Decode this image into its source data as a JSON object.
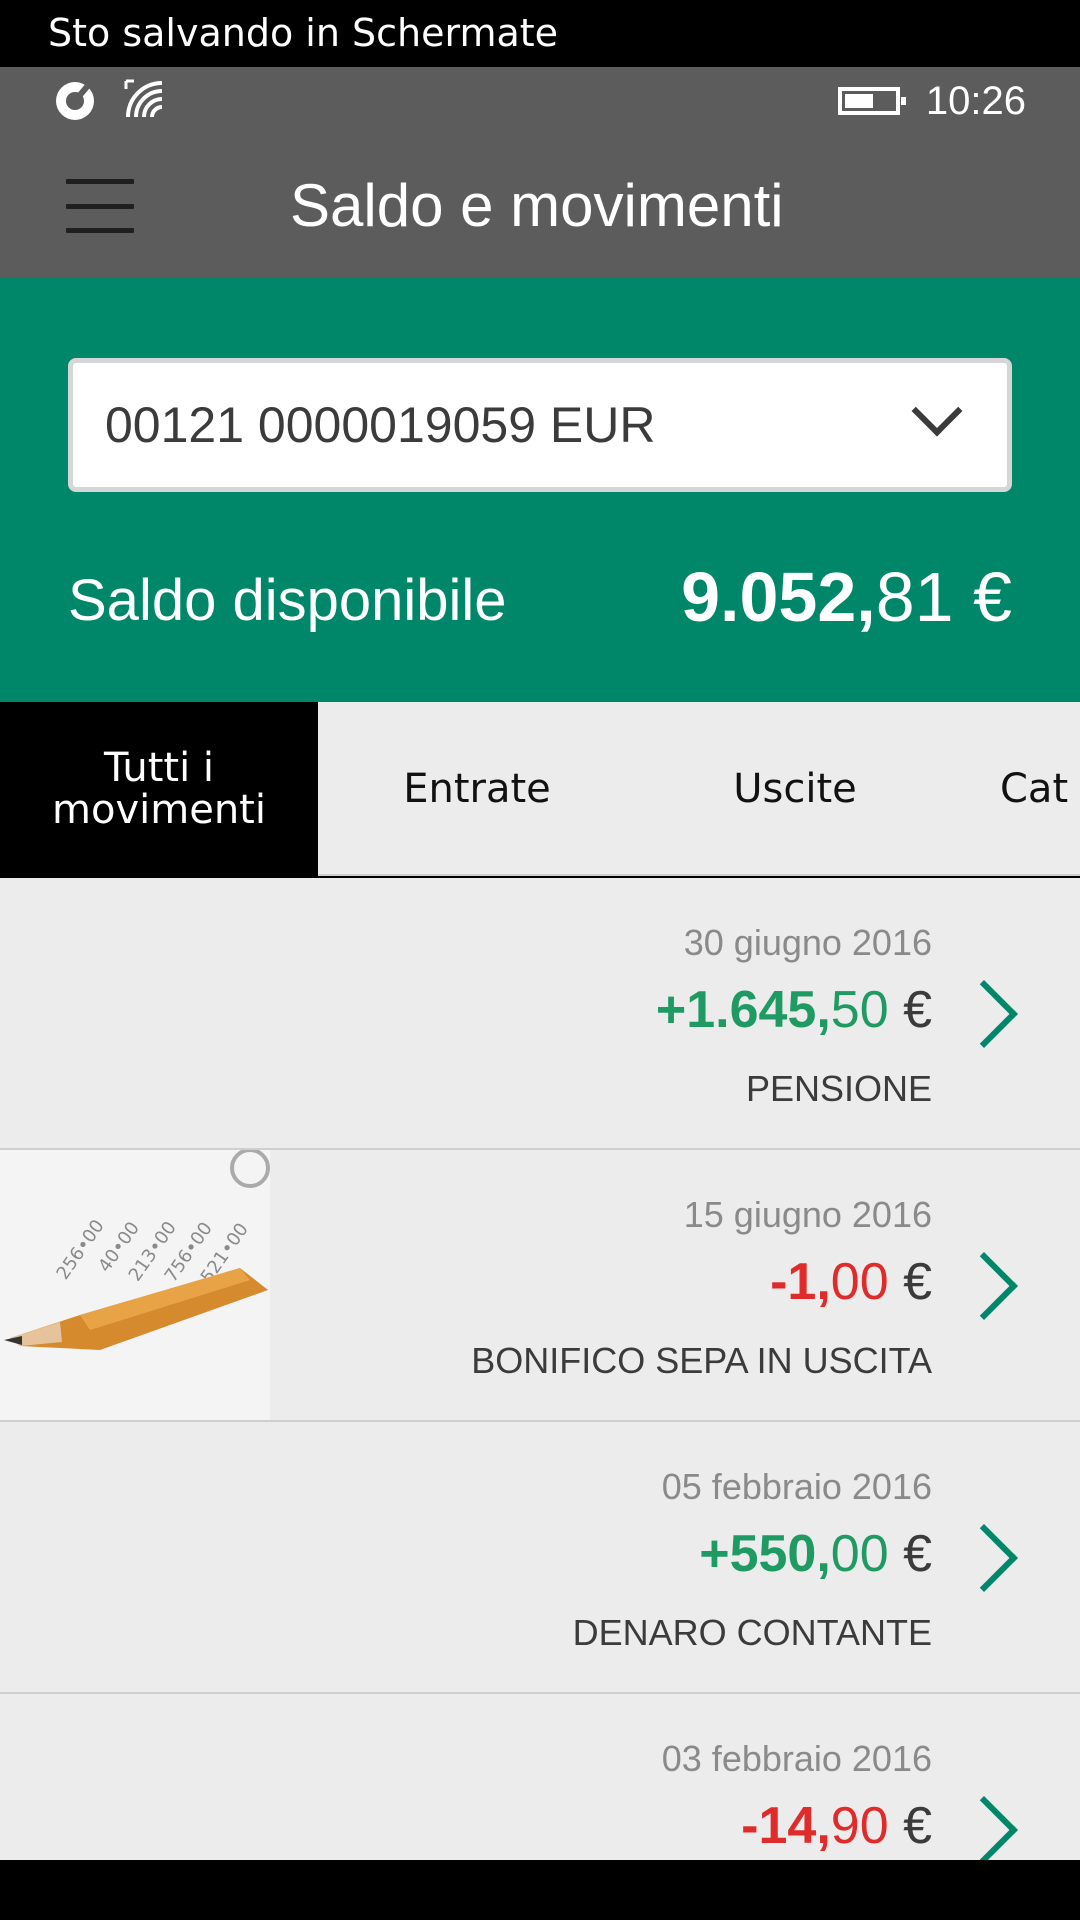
{
  "notification": {
    "text": "Sto salvando in Schermate"
  },
  "status_bar": {
    "time": "10:26",
    "battery_level": 0.5,
    "icons": [
      "screen-capture-icon",
      "wifi-icon"
    ]
  },
  "header": {
    "title": "Saldo e movimenti",
    "menu_icon": "hamburger-menu-icon"
  },
  "account": {
    "selected": "00121 0000019059 EUR",
    "balance_label": "Saldo disponibile",
    "balance_int": "9.052,",
    "balance_dec": "81 €"
  },
  "tabs": [
    {
      "label": "Tutti i movimenti",
      "active": true
    },
    {
      "label": "Entrate",
      "active": false
    },
    {
      "label": "Uscite",
      "active": false
    },
    {
      "label": "Cat",
      "active": false
    }
  ],
  "transactions": [
    {
      "date": "30 giugno 2016",
      "amount_int": "+1.645,",
      "amount_dec": "50 €",
      "description": "PENSIONE",
      "type": "credit"
    },
    {
      "date": "15 giugno 2016",
      "amount_int": "-1,",
      "amount_dec": "00 €",
      "description": "BONIFICO SEPA IN USCITA",
      "type": "debit",
      "has_image": true
    },
    {
      "date": "05 febbraio 2016",
      "amount_int": "+550,",
      "amount_dec": "00 €",
      "description": "DENARO CONTANTE",
      "type": "credit"
    },
    {
      "date": "03 febbraio 2016",
      "amount_int": "-14,",
      "amount_dec": "90 €",
      "description": "",
      "type": "debit"
    }
  ],
  "colors": {
    "accent": "#00876a",
    "header": "#5c5c5c",
    "credit": "#1f9a63",
    "debit": "#e02b2b"
  }
}
